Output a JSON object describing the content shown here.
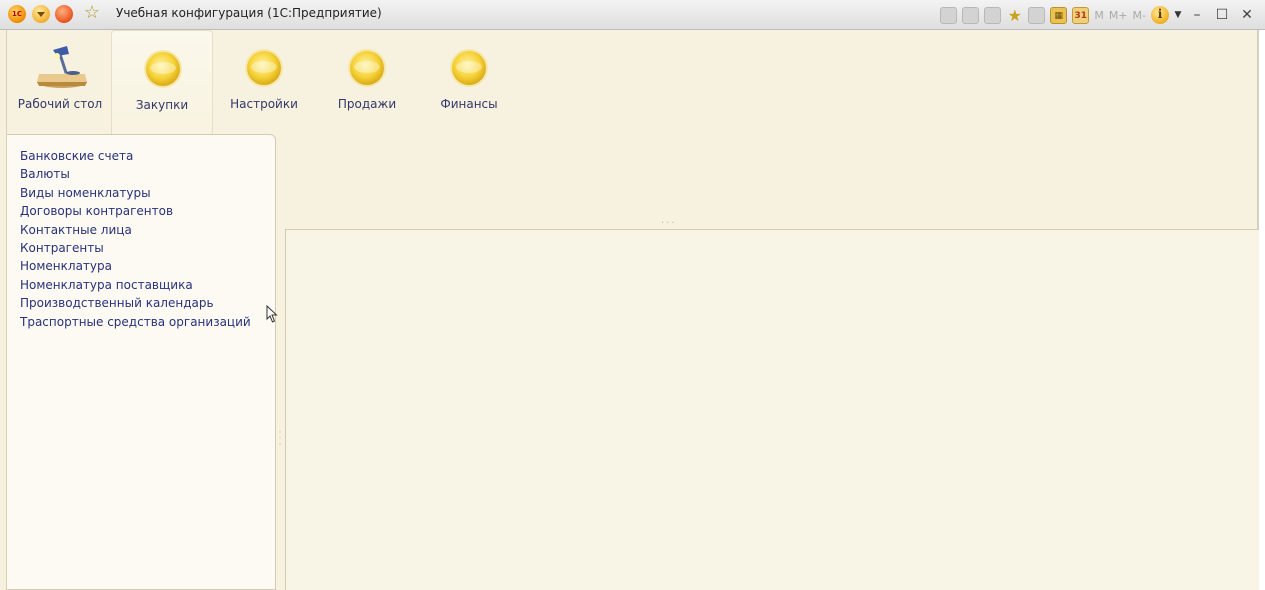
{
  "window": {
    "title": "Учебная конфигурация (1С:Предприятие)",
    "logo_text": "1С"
  },
  "toolbar": {
    "memory_buttons": [
      "M",
      "M+",
      "M-"
    ],
    "calendar_label": "31"
  },
  "sections": [
    {
      "label": "Рабочий стол",
      "icon": "desktop-icon",
      "active": false
    },
    {
      "label": "Закупки",
      "icon": "section-icon",
      "active": true
    },
    {
      "label": "Настройки",
      "icon": "section-icon",
      "active": false
    },
    {
      "label": "Продажи",
      "icon": "section-icon",
      "active": false
    },
    {
      "label": "Финансы",
      "icon": "section-icon",
      "active": false
    }
  ],
  "navigation": {
    "items": [
      "Банковские счета",
      "Валюты",
      "Виды номенклатуры",
      "Договоры контрагентов",
      "Контактные лица",
      "Контрагенты",
      "Номенклатура",
      "Номенклатура поставщика",
      "Производственный календарь",
      "Траспортные средства организаций"
    ]
  },
  "colors": {
    "background": "#f7f2df",
    "nav_link": "#28327a",
    "section_label": "#34386a",
    "accent": "#f6d33a"
  }
}
